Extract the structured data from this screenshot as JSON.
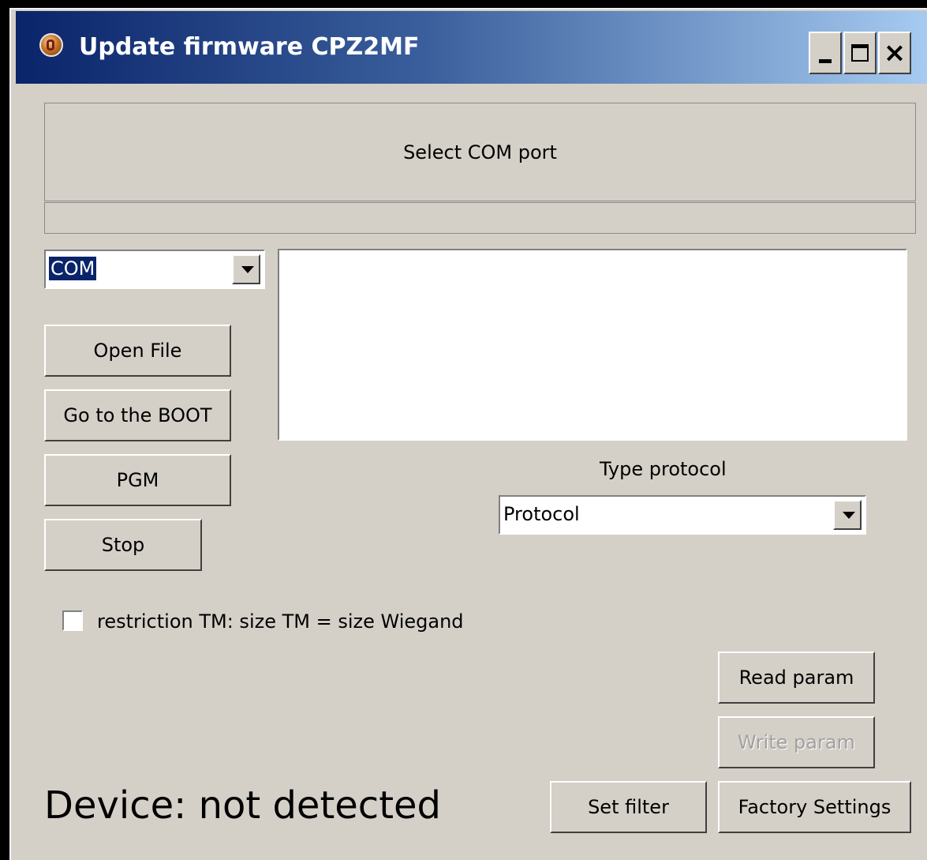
{
  "window": {
    "title": "Update firmware CPZ2MF",
    "minimize": "_",
    "close": "×"
  },
  "status": {
    "message": "Select COM port",
    "progress": 0
  },
  "com_select": {
    "value": "COM"
  },
  "log": {
    "text": ""
  },
  "buttons": {
    "open_file": "Open File",
    "boot": "Go to the BOOT",
    "pgm": "PGM",
    "stop": "Stop",
    "read_param": "Read param",
    "write_param": "Write param",
    "set_filter": "Set filter",
    "factory_settings": "Factory Settings"
  },
  "protocol": {
    "label": "Type protocol",
    "value": "Protocol"
  },
  "restriction": {
    "label": "restriction TM: size TM = size Wiegand",
    "checked": false
  },
  "device": {
    "status": "Device: not detected"
  },
  "colors": {
    "titlebar_start": "#0a246a",
    "titlebar_end": "#a6caf0",
    "face": "#d4d0c8"
  }
}
